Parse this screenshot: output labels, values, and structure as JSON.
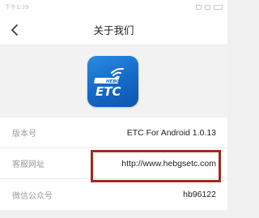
{
  "status_bar": {
    "time": "下午1:39"
  },
  "header": {
    "title": "关于我们"
  },
  "app": {
    "logo_text": "ETC",
    "logo_badge": "HEB03"
  },
  "info": [
    {
      "label": "版本号",
      "value": "ETC For Android 1.0.13"
    },
    {
      "label": "客服网址",
      "value": "http://www.hebgsetc.com"
    },
    {
      "label": "微信公众号",
      "value": "hb96122"
    }
  ],
  "colors": {
    "highlight": "#a0291f",
    "logo_blue": "#1468c6"
  }
}
